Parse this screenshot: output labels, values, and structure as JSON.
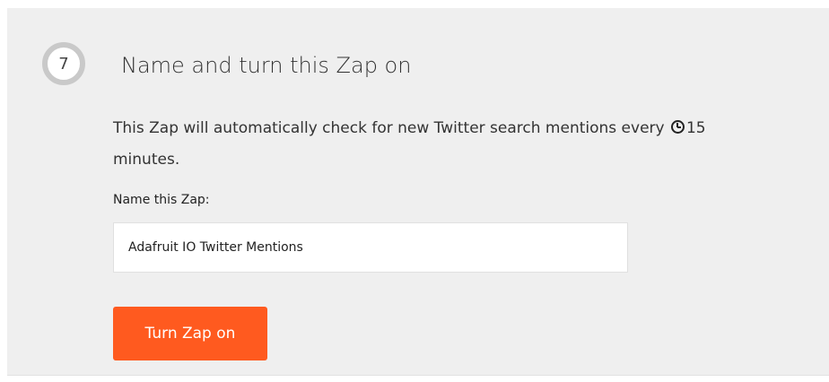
{
  "step": {
    "number": "7",
    "title": "Name and turn this Zap on"
  },
  "description": {
    "text_before": "This Zap will automatically check for new Twitter search mentions every",
    "interval": "15",
    "text_after": "minutes.",
    "icon": "clock-icon"
  },
  "name_field": {
    "label": "Name this Zap:",
    "value": "Adafruit IO Twitter Mentions"
  },
  "actions": {
    "turn_on_label": "Turn Zap on"
  },
  "colors": {
    "button": "#ff5a1f",
    "panel": "#efefef",
    "step_ring": "#c9c9c9"
  }
}
